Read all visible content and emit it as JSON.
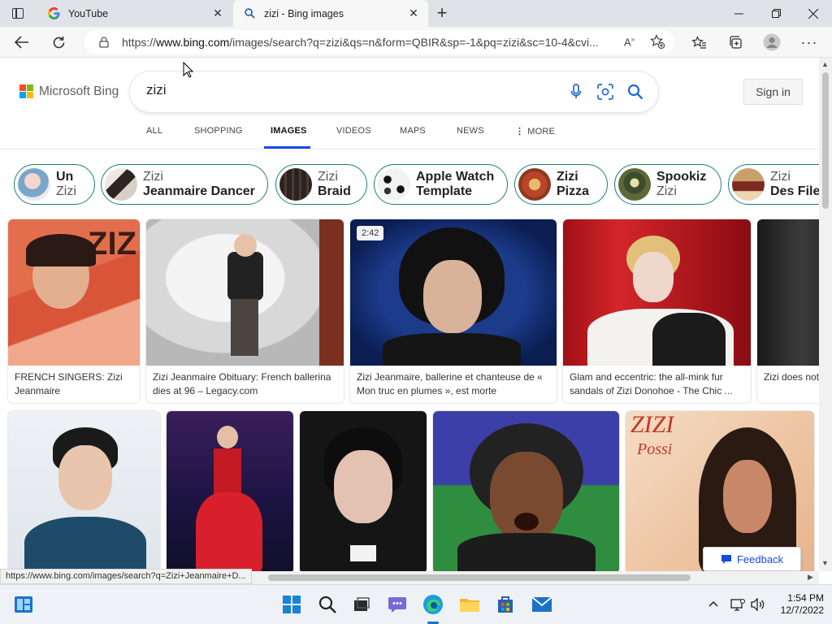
{
  "browser": {
    "tabs": [
      {
        "title": "YouTube",
        "icon": "google-icon",
        "active": false
      },
      {
        "title": "zizi - Bing images",
        "icon": "search-icon",
        "active": true
      }
    ],
    "address": {
      "prefix": "https://",
      "domain": "www.bing.com",
      "path": "/images/search?q=zizi&qs=n&form=QBIR&sp=-1&pq=zizi&sc=10-4&cvi..."
    }
  },
  "bing": {
    "logo_text": "Microsoft Bing",
    "query": "zizi",
    "sign_in": "Sign in",
    "scopes": [
      "ALL",
      "SHOPPING",
      "IMAGES",
      "VIDEOS",
      "MAPS",
      "NEWS",
      "MORE"
    ],
    "active_scope": "IMAGES",
    "related": [
      {
        "line1": "Un",
        "line2": "Zizi",
        "bold_line": 1
      },
      {
        "line1": "Zizi",
        "line2": "Jeanmaire Dancer",
        "bold_line": 2
      },
      {
        "line1": "Zizi",
        "line2": "Braid",
        "bold_line": 2
      },
      {
        "line1": "Apple Watch",
        "line2": "Template",
        "bold_line": 0
      },
      {
        "line1": "Zizi",
        "line2": "Pizza",
        "bold_line": 0
      },
      {
        "line1": "Spookiz",
        "line2": "Zizi",
        "bold_line": 1
      },
      {
        "line1": "Zizi",
        "line2": "Des File",
        "bold_line": 2
      }
    ],
    "row1": [
      {
        "caption": "FRENCH SINGERS: Zizi Jeanmaire",
        "duration": ""
      },
      {
        "caption": "Zizi Jeanmaire Obituary: French ballerina dies at 96 – Legacy.com",
        "duration": ""
      },
      {
        "caption": "Zizi Jeanmaire, ballerine et chanteuse de « Mon truc en plumes », est morte",
        "duration": "2:42"
      },
      {
        "caption": "Glam and eccentric: the all-mink fur sandals of Zizi Donohoe - The Chic ...",
        "duration": ""
      },
      {
        "caption": "Zizi does not",
        "duration": ""
      }
    ],
    "row2_overlay_text": [
      "ZIZI",
      "Possi"
    ],
    "feedback": "Feedback",
    "status_url": "https://www.bing.com/images/search?q=Zizi+Jeanmaire+D..."
  },
  "taskbar": {
    "time": "1:54 PM",
    "date": "12/7/2022"
  },
  "colors": {
    "accent": "#174ae4",
    "pill_border": "#1e7f7a"
  }
}
